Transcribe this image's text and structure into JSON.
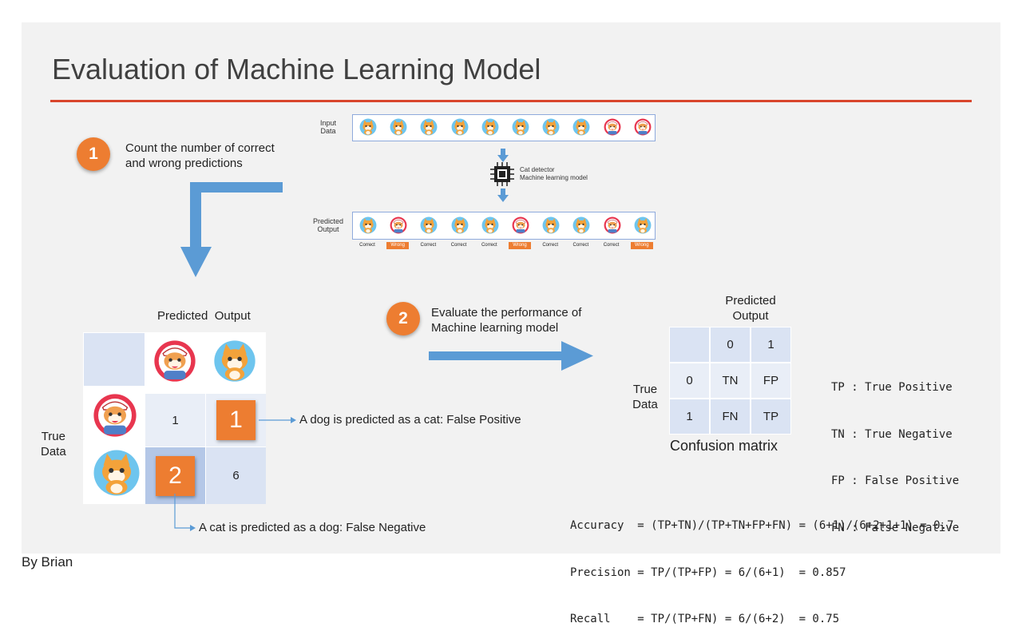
{
  "title": "Evaluation of Machine Learning Model",
  "colors": {
    "accent": "#d9462d",
    "step_orange": "#ed7d31",
    "arrow_blue": "#5b9bd5",
    "cell_light": "#dae3f3",
    "cell_lighter": "#e9eef7",
    "cell_dark": "#b4c7e7",
    "wrong_badge": "#ed7d31"
  },
  "step1": {
    "number": "1",
    "text_line1": "Count the number of correct",
    "text_line2": "and wrong predictions"
  },
  "step2": {
    "number": "2",
    "text_line1": "Evaluate the performance of",
    "text_line2": "Machine learning model"
  },
  "pipeline": {
    "input_label_line1": "Input",
    "input_label_line2": "Data",
    "model_label_line1": "Cat detector",
    "model_label_line2": "Machine learning model",
    "output_label_line1": "Predicted",
    "output_label_line2": "Output",
    "input_items": [
      "cat",
      "cat",
      "cat",
      "cat",
      "cat",
      "cat",
      "cat",
      "cat",
      "dog",
      "dog"
    ],
    "output_items": [
      "cat",
      "dog",
      "cat",
      "cat",
      "cat",
      "dog",
      "cat",
      "cat",
      "dog",
      "cat"
    ],
    "results": [
      "Correct",
      "Wrong",
      "Correct",
      "Correct",
      "Correct",
      "Wrong",
      "Correct",
      "Correct",
      "Correct",
      "Wrong"
    ]
  },
  "matrix1": {
    "header": "Predicted  Output",
    "row_label_line1": "True",
    "row_label_line2": "Data",
    "col_icons": [
      "dog-face-icon",
      "cat-face-icon"
    ],
    "row_icons": [
      "dog-face-icon",
      "cat-face-icon"
    ],
    "cells": [
      [
        "1",
        "1"
      ],
      [
        "2",
        "6"
      ]
    ],
    "fp_note": "A dog is predicted as a cat: False Positive",
    "fn_note": "A cat is predicted as a dog: False Negative"
  },
  "confusion": {
    "header_line1": "Predicted",
    "header_line2": "Output",
    "row_label_line1": "True",
    "row_label_line2": "Data",
    "col_headers": [
      "0",
      "1"
    ],
    "row_headers": [
      "0",
      "1"
    ],
    "cells": [
      [
        "TN",
        "FP"
      ],
      [
        "FN",
        "TP"
      ]
    ],
    "caption": "Confusion matrix"
  },
  "legend": [
    "TP : True Positive",
    "TN : True Negative",
    "FP : False Positive",
    "FN : False Negative"
  ],
  "formulas": [
    "Accuracy  = (TP+TN)/(TP+TN+FP+FN) = (6+1)/(6+2+1+1) = 0.7",
    "Precision = TP/(TP+FP) = 6/(6+1)  = 0.857",
    "Recall    = TP/(TP+FN) = 6/(6+2)  = 0.75"
  ],
  "author": "By Brian"
}
